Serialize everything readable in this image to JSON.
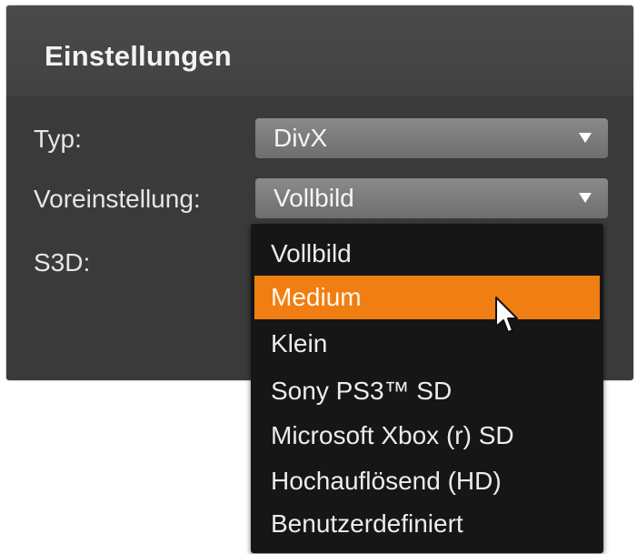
{
  "panel": {
    "title": "Einstellungen"
  },
  "fields": {
    "typ_label": "Typ:",
    "typ_value": "DivX",
    "preset_label": "Voreinstellung:",
    "preset_value": "Vollbild",
    "s3d_label": "S3D:"
  },
  "dropdown": {
    "items": [
      "Vollbild",
      "Medium",
      "Klein",
      "Sony PS3™ SD",
      "Microsoft Xbox (r) SD",
      "Hochauflösend (HD)",
      "Benutzerdefiniert"
    ],
    "highlighted": "Medium"
  },
  "colors": {
    "highlight": "#f07e12",
    "panel_bg": "#3a3a3a",
    "dropdown_bg": "#161616"
  },
  "icons": {
    "arrow": "triangle-down",
    "cursor": "mouse-pointer"
  }
}
